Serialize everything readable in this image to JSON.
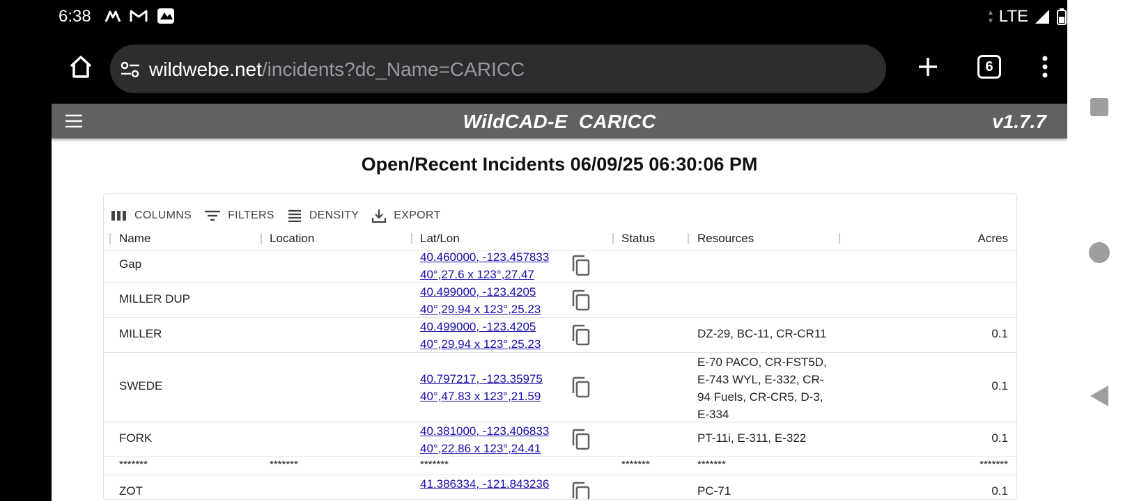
{
  "status_bar": {
    "time": "6:38",
    "network": "LTE",
    "notif_icons": [
      "maps-icon",
      "gmail-icon",
      "app-icon"
    ]
  },
  "browser": {
    "url_host": "wildwebe.net",
    "url_path": "/incidents?dc_Name=CARICC",
    "tab_count": "6"
  },
  "app": {
    "title": "WildCAD-E  CARICC",
    "version": "v1.7.7"
  },
  "page": {
    "title": "Open/Recent Incidents 06/09/25 06:30:06 PM"
  },
  "grid_toolbar": {
    "columns": "COLUMNS",
    "filters": "FILTERS",
    "density": "DENSITY",
    "export": "EXPORT"
  },
  "columns": {
    "name": "Name",
    "location": "Location",
    "latlon": "Lat/Lon",
    "status": "Status",
    "resources": "Resources",
    "acres": "Acres"
  },
  "rows": [
    {
      "name": "Gap",
      "location": "",
      "latlon_dec": "40.460000, -123.457833",
      "latlon_dm": "40°,27.6 x 123°,27.47",
      "status": "",
      "resources": "",
      "acres": ""
    },
    {
      "name": "MILLER DUP",
      "location": "",
      "latlon_dec": "40.499000, -123.4205",
      "latlon_dm": "40°,29.94 x 123°,25.23",
      "status": "",
      "resources": "",
      "acres": ""
    },
    {
      "name": "MILLER",
      "location": "",
      "latlon_dec": "40.499000, -123.4205",
      "latlon_dm": "40°,29.94 x 123°,25.23",
      "status": "",
      "resources": "DZ-29, BC-11, CR-CR11",
      "acres": "0.1"
    },
    {
      "name": "SWEDE",
      "location": "",
      "latlon_dec": "40.797217, -123.35975",
      "latlon_dm": "40°,47.83 x 123°,21.59",
      "status": "",
      "resources": "E-70 PACO, CR-FST5D, E-743 WYL, E-332, CR-94 Fuels, CR-CR5, D-3, E-334",
      "acres": "0.1"
    },
    {
      "name": "FORK",
      "location": "",
      "latlon_dec": "40.381000, -123.406833",
      "latlon_dm": "40°,22.86 x 123°,24.41",
      "status": "",
      "resources": "PT-11i, E-311, E-322",
      "acres": "0.1"
    },
    {
      "name": "*******",
      "location": "*******",
      "latlon_dec": "*******",
      "latlon_dm": "",
      "status": "*******",
      "resources": "*******",
      "acres": "*******"
    },
    {
      "name": "ZOT",
      "location": "",
      "latlon_dec": "41.386334, -121.843236",
      "latlon_dm": "",
      "status": "",
      "resources": "PC-71",
      "acres": "0.1"
    }
  ]
}
